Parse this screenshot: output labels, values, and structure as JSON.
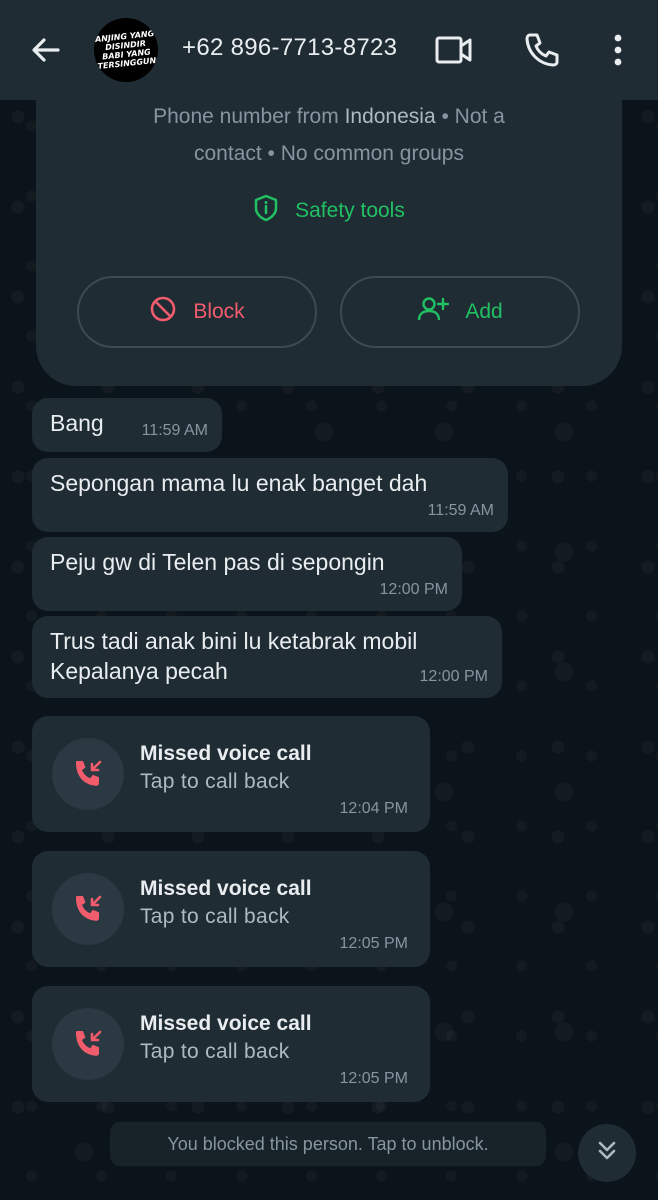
{
  "header": {
    "title": "+62 896-7713-8723",
    "avatar_text": "ANJING YANG DISINDIR BABI YANG TERSINGGUNG",
    "icons": [
      "back-arrow-icon",
      "video-call-icon",
      "voice-call-icon",
      "more-vert-icon"
    ]
  },
  "info_card": {
    "line1_prefix": "Phone number from ",
    "country": "Indonesia",
    "line1_suffix": " • Not a",
    "line2": "contact • No common groups",
    "safety_label": "Safety tools",
    "block_label": "Block",
    "add_label": "Add"
  },
  "messages": [
    {
      "text": "Bang",
      "time": "11:59 AM"
    },
    {
      "text": "Sepongan mama lu enak banget dah",
      "time": "11:59 AM"
    },
    {
      "text": "Peju gw di Telen pas di sepongin",
      "time": "12:00 PM"
    },
    {
      "text": "Trus tadi anak bini lu ketabrak mobil\nKepalanya pecah",
      "time": "12:00 PM"
    }
  ],
  "calls": [
    {
      "title": "Missed voice call",
      "subtitle": "Tap to call back",
      "time": "12:04 PM"
    },
    {
      "title": "Missed voice call",
      "subtitle": "Tap to call back",
      "time": "12:05 PM"
    },
    {
      "title": "Missed voice call",
      "subtitle": "Tap to call back",
      "time": "12:05 PM"
    }
  ],
  "blocked_notice": "You blocked this person. Tap to unblock.",
  "colors": {
    "accent_green": "#21c063",
    "danger_red": "#f15c6d",
    "bubble": "#1f2c34",
    "background": "#0b141a"
  }
}
